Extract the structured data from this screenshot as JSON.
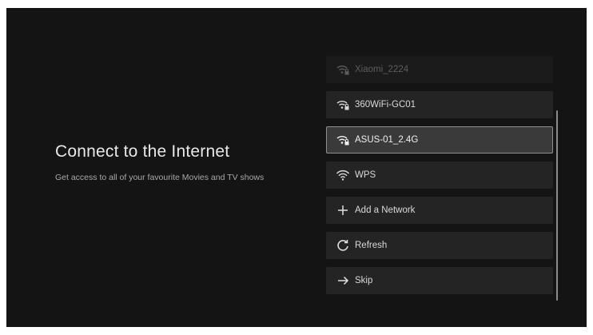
{
  "page": {
    "title": "Connect to the Internet",
    "subtitle": "Get access to all of your favourite Movies and TV shows"
  },
  "networks": [
    {
      "label": "Xiaomi_2224",
      "icon": "wifi-locked-icon"
    },
    {
      "label": "360WiFi-GC01",
      "icon": "wifi-locked-icon"
    },
    {
      "label": "ASUS-01_2.4G",
      "icon": "wifi-locked-icon"
    },
    {
      "label": "WPS",
      "icon": "wifi-icon"
    }
  ],
  "actions": {
    "add_network": {
      "label": "Add a Network",
      "icon": "plus-icon"
    },
    "refresh": {
      "label": "Refresh",
      "icon": "refresh-icon"
    },
    "skip": {
      "label": "Skip",
      "icon": "arrow-right-icon"
    }
  },
  "colors": {
    "background": "#141414",
    "item": "#242424",
    "item_selected": "#3a3a3a",
    "selected_border": "#8f8f8f",
    "text": "#d9d9d9"
  }
}
